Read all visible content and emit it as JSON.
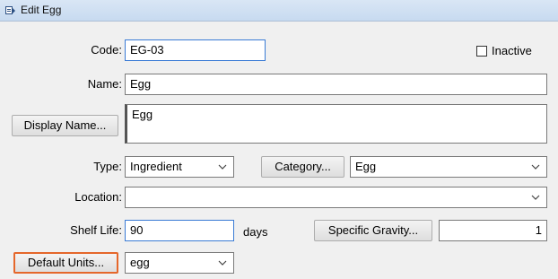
{
  "window": {
    "title": "Edit Egg"
  },
  "form": {
    "code": {
      "label": "Code:",
      "value": "EG-03"
    },
    "inactive": {
      "label": "Inactive",
      "checked": false
    },
    "name": {
      "label": "Name:",
      "value": "Egg"
    },
    "display_name": {
      "button": "Display Name...",
      "value": "Egg"
    },
    "type": {
      "label": "Type:",
      "value": "Ingredient"
    },
    "category": {
      "button": "Category...",
      "value": "Egg"
    },
    "location": {
      "label": "Location:",
      "value": ""
    },
    "shelf_life": {
      "label": "Shelf Life:",
      "value": "90",
      "unit": "days"
    },
    "specific_gravity": {
      "button": "Specific Gravity...",
      "value": "1"
    },
    "default_units": {
      "button": "Default Units...",
      "value": "egg"
    }
  },
  "icons": {
    "window": "edit-window-icon",
    "dropdown": "chevron-down-icon"
  },
  "colors": {
    "focus_border": "#3a7bd5",
    "highlight_border": "#e5672b",
    "title_bg": "#d9e6f5"
  }
}
